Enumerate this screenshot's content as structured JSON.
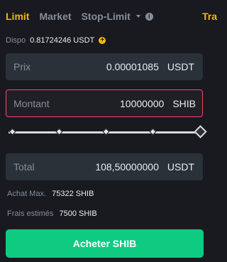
{
  "tabs": {
    "limit": "Limit",
    "market": "Market",
    "stop_limit": "Stop-Limit",
    "info_icon": "info-icon",
    "extra": "Tra"
  },
  "available": {
    "label": "Dispo",
    "value": "0.81724246 USDT",
    "add_icon": "plus-circle-icon"
  },
  "price": {
    "label": "Prix",
    "value": "0.00001085",
    "unit": "USDT"
  },
  "amount": {
    "label": "Montant",
    "value": "10000000",
    "unit": "SHIB"
  },
  "slider": {
    "percent": 100,
    "marks": [
      0,
      25,
      50,
      75,
      100
    ]
  },
  "total": {
    "label": "Total",
    "value": "108,50000000",
    "unit": "USDT"
  },
  "max_buy": {
    "label": "Achat Max.",
    "value": "75322 SHIB"
  },
  "estimated_fees": {
    "label": "Frais estimés",
    "value": "7500 SHIB"
  },
  "buy_button": {
    "label": "Acheter SHIB",
    "color": "#0ecb81"
  },
  "colors": {
    "accent": "#f0b90b",
    "error_border": "#f6465d",
    "background": "#181a20",
    "field": "#2b3139"
  }
}
